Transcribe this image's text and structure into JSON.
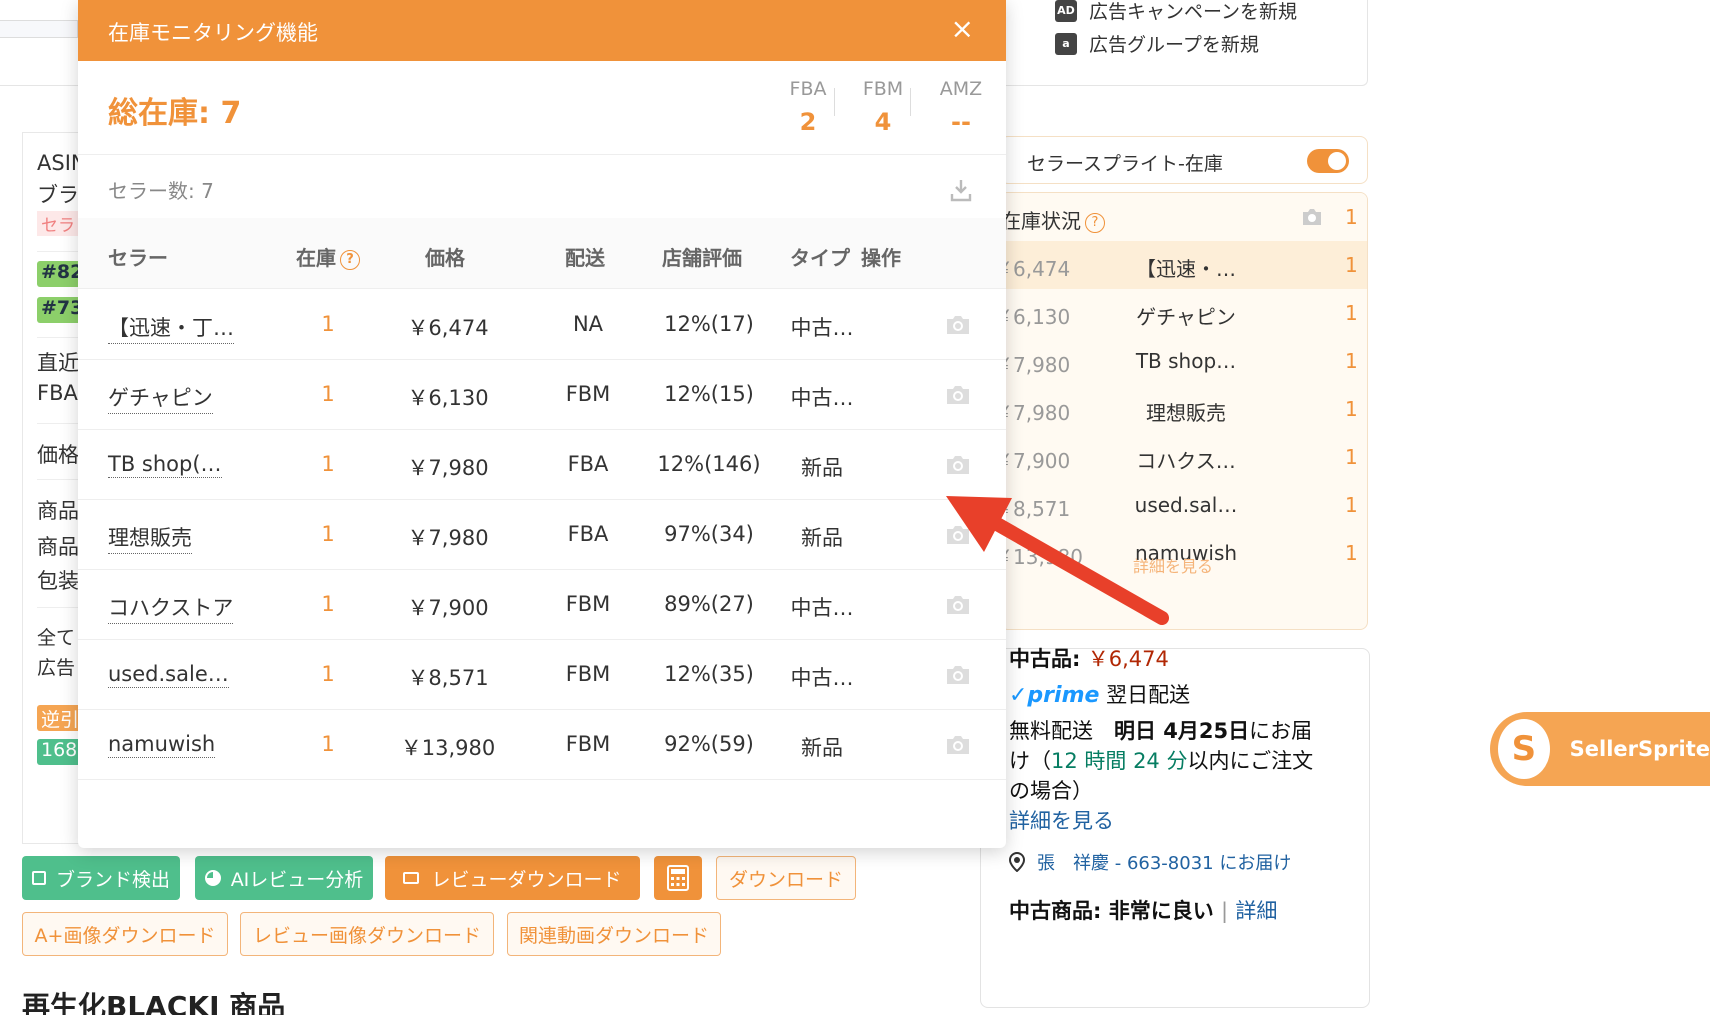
{
  "modal": {
    "title": "在庫モニタリング機能",
    "close": "×",
    "total_label": "総在庫: 7",
    "stats": [
      {
        "key": "FBA",
        "value": "2"
      },
      {
        "key": "FBM",
        "value": "4"
      },
      {
        "key": "AMZ",
        "value": "--"
      }
    ],
    "seller_count": "セラー数: 7",
    "columns": {
      "seller": "セラー",
      "stock": "在庫",
      "price": "価格",
      "ship": "配送",
      "rating": "店舗評価",
      "type": "タイプ",
      "action": "操作"
    },
    "rows": [
      {
        "seller": "【迅速・丁…",
        "stock": "1",
        "price": "￥6,474",
        "ship": "NA",
        "rating": "12%(17)",
        "type": "中古…"
      },
      {
        "seller": "ゲチャピン",
        "stock": "1",
        "price": "￥6,130",
        "ship": "FBM",
        "rating": "12%(15)",
        "type": "中古…"
      },
      {
        "seller": "TB shop(…",
        "stock": "1",
        "price": "￥7,980",
        "ship": "FBA",
        "rating": "12%(146)",
        "type": "新品"
      },
      {
        "seller": "理想販売",
        "stock": "1",
        "price": "￥7,980",
        "ship": "FBA",
        "rating": "97%(34)",
        "type": "新品"
      },
      {
        "seller": "コハクストア",
        "stock": "1",
        "price": "￥7,900",
        "ship": "FBM",
        "rating": "89%(27)",
        "type": "中古…"
      },
      {
        "seller": "used.sale…",
        "stock": "1",
        "price": "￥8,571",
        "ship": "FBM",
        "rating": "12%(35)",
        "type": "中古…"
      },
      {
        "seller": "namuwish",
        "stock": "1",
        "price": "￥13,980",
        "ship": "FBM",
        "rating": "92%(59)",
        "type": "新品"
      }
    ]
  },
  "left_panel": {
    "asin": "ASIN",
    "brand": "ブラ",
    "seller_tag": "セラ",
    "rank1": "#82",
    "rank2": "#73",
    "recent": "直近",
    "fba": "FBA",
    "price": "価格",
    "product1": "商品",
    "product2": "商品",
    "package": "包装",
    "all": "全て",
    "ad": "広告",
    "reverse": "逆引",
    "num": "168"
  },
  "buttons": {
    "brand_detect": "ブランド検出",
    "ai_review": "AIレビュー分析",
    "review_download": "レビューダウンロード",
    "download": "ダウンロード",
    "aplus_download": "A+画像ダウンロード",
    "review_image_download": "レビュー画像ダウンロード",
    "related_video_download": "関連動画ダウンロード"
  },
  "heading_partial": "再生化BLACKI   商品　",
  "ads": {
    "new_campaign": "広告キャンペーンを新規",
    "new_group": "広告グループを新規",
    "ad_icon1": "AD",
    "ad_icon2": "a"
  },
  "stock_widget": {
    "title": "セラースプライト-在庫",
    "status_label": "在庫状況",
    "status_count": "1",
    "rows": [
      {
        "price": "￥6,474",
        "name": "【迅速・…",
        "count": "1"
      },
      {
        "price": "￥6,130",
        "name": "ゲチャピン",
        "count": "1"
      },
      {
        "price": "￥7,980",
        "name": "TB shop…",
        "count": "1"
      },
      {
        "price": "￥7,980",
        "name": "理想販売",
        "count": "1"
      },
      {
        "price": "￥7,900",
        "name": "コハクス…",
        "count": "1"
      },
      {
        "price": "￥8,571",
        "name": "used.sal…",
        "count": "1"
      },
      {
        "price": "￥13,980",
        "name": "namuwish",
        "count": "1"
      }
    ],
    "more": "詳細を見る"
  },
  "buy_box": {
    "used_label": "中古品: ",
    "used_price": "￥6,474",
    "prime": "✓prime",
    "next_day": "翌日配送",
    "free_ship_line1a": "無料配送　",
    "free_ship_line1b": "明日 4月25日",
    "free_ship_line1c": "にお届",
    "free_ship_line2a": "け（",
    "free_ship_line2b": "12 時間 24 分",
    "free_ship_line2c": "以内にご注文",
    "free_ship_line3": "の場合）",
    "details": "詳細を見る",
    "address": "張　祥慶 - 663-8031 にお届け",
    "condition_label": "中古商品: 非常に良い",
    "condition_sep": "|",
    "condition_link": "詳細"
  },
  "sellersprite": {
    "text": "SellerSprite",
    "logo": "S"
  },
  "colors": {
    "accent": "#f0923a",
    "green": "#4fbf8c",
    "arrow": "#e8402a"
  }
}
